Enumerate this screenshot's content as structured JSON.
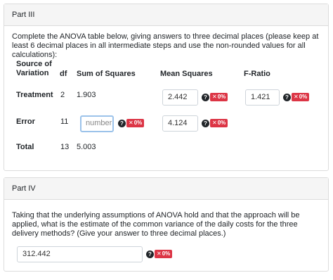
{
  "part3": {
    "title": "Part III",
    "instructions": "Complete the ANOVA table below, giving answers to three decimal places (please keep at least 6 decimal places in all intermediate steps and use the non-rounded values for all calculations):",
    "headers": {
      "source_line1": "Source of",
      "source_line2": "Variation",
      "df": "df",
      "ss": "Sum of Squares",
      "ms": "Mean Squares",
      "f": "F-Ratio"
    },
    "rows": [
      {
        "source": "Treatment",
        "df": "2",
        "ss": "1.903",
        "ms": "2.442",
        "f": "1.421"
      },
      {
        "source": "Error",
        "df": "11",
        "ss_placeholder": "number",
        "ms": "4.124"
      },
      {
        "source": "Total",
        "df": "13",
        "ss": "5.003"
      }
    ]
  },
  "part4": {
    "title": "Part IV",
    "question": "Taking that the underlying assumptions of ANOVA hold and that the approach will be applied, what is the estimate of the common variance of the daily costs for the three delivery methods? (Give your answer to three decimal places.)",
    "answer": "312.442"
  },
  "feedback": {
    "help_symbol": "?",
    "cross_symbol": "✕",
    "score_label": "0%"
  },
  "colors": {
    "badge_red": "#dc3545",
    "focus_blue": "#9cc3ea",
    "header_bg": "#f5f5f5"
  }
}
